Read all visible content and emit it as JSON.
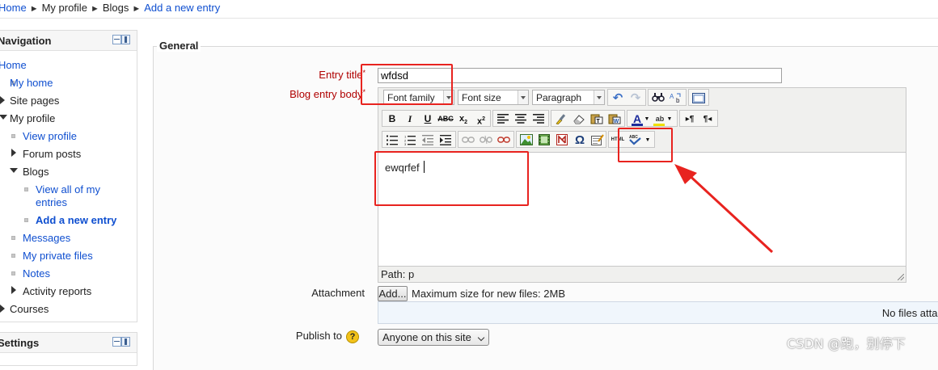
{
  "breadcrumb": {
    "items": [
      "Home",
      "My profile",
      "Blogs",
      "Add a new entry"
    ],
    "separator": "►"
  },
  "navigation": {
    "title": "Navigation",
    "items": {
      "home": "Home",
      "my_home": "My home",
      "site_pages": "Site pages",
      "my_profile": "My profile",
      "view_profile": "View profile",
      "forum_posts": "Forum posts",
      "blogs": "Blogs",
      "view_all_line1": "View all of my",
      "view_all_line2": "entries",
      "add_new_entry": "Add a new entry",
      "messages": "Messages",
      "my_private_files": "My private files",
      "notes": "Notes",
      "activity_reports": "Activity reports",
      "courses": "Courses"
    }
  },
  "settings": {
    "title": "Settings"
  },
  "form": {
    "legend": "General",
    "entry_title_label": "Entry title",
    "entry_title_value": "wfdsd",
    "blog_body_label": "Blog entry body",
    "required_mark": "*",
    "attachment_label": "Attachment",
    "add_button": "Add...",
    "max_size_text": "Maximum size for new files: 2MB",
    "no_files_text": "No files attac",
    "publish_label": "Publish to",
    "publish_value": "Anyone on this site"
  },
  "editor": {
    "font_family": "Font family",
    "font_size": "Font size",
    "format": "Paragraph",
    "content": "ewqrfef",
    "path": "Path: p"
  },
  "colors": {
    "link": "#0f4fd0",
    "required_label": "#b00000",
    "annotation_red": "#e8231f",
    "help_icon": "#f2c21a"
  },
  "watermark": "CSDN @跑，别停下"
}
